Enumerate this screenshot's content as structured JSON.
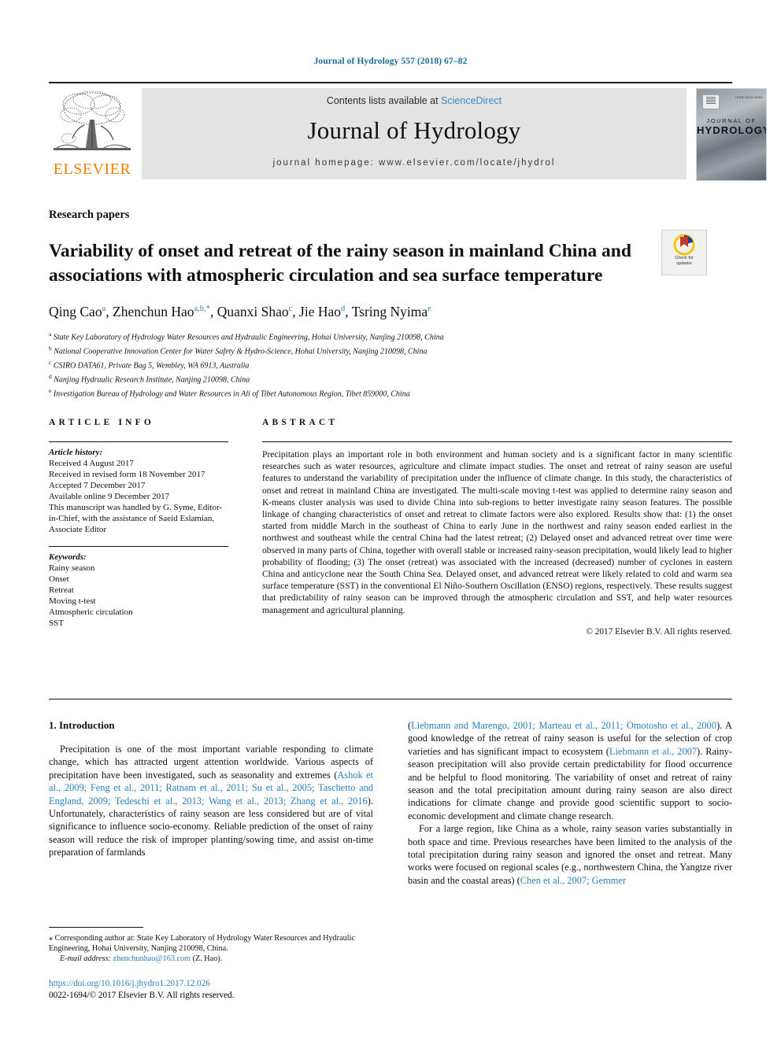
{
  "running_head": "Journal of Hydrology 557 (2018) 67–82",
  "masthead": {
    "publisher": "ELSEVIER",
    "contents_prefix": "Contents lists available at ",
    "contents_link": "ScienceDirect",
    "journal_title": "Journal of Hydrology",
    "homepage": "journal homepage: www.elsevier.com/locate/jhydrol",
    "cover": {
      "top_right": "ISSN 0022-1694",
      "line1": "JOURNAL OF",
      "line2": "HYDROLOGY"
    }
  },
  "article": {
    "type": "Research papers",
    "title": "Variability of onset and retreat of the rainy season in mainland China and associations with atmospheric circulation and sea surface temperature",
    "crossmark_line1": "Check for",
    "crossmark_line2": "updates"
  },
  "authors": {
    "list": [
      {
        "name": "Qing Cao",
        "sup": "a"
      },
      {
        "name": "Zhenchun Hao",
        "sup": "a,b,*"
      },
      {
        "name": "Quanxi Shao",
        "sup": "c"
      },
      {
        "name": "Jie Hao",
        "sup": "d"
      },
      {
        "name": "Tsring Nyima",
        "sup": "e"
      }
    ],
    "affiliations": [
      {
        "label": "a",
        "text": "State Key Laboratory of Hydrology Water Resources and Hydraulic Engineering, Hohai University, Nanjing 210098, China"
      },
      {
        "label": "b",
        "text": "National Cooperative Innovation Center for Water Safety & Hydro-Science, Hohai University, Nanjing 210098, China"
      },
      {
        "label": "c",
        "text": "CSIRO DATA61, Private Bag 5, Wembley, WA 6913, Australia"
      },
      {
        "label": "d",
        "text": "Nanjing Hydraulic Research Institute, Nanjing 210098, China"
      },
      {
        "label": "e",
        "text": "Investigation Bureau of Hydrology and Water Resources in Ali of Tibet Autonomous Region, Tibet 859000, China"
      }
    ]
  },
  "article_info": {
    "heading": "ARTICLE INFO",
    "history_label": "Article history:",
    "history": [
      "Received 4 August 2017",
      "Received in revised form 18 November 2017",
      "Accepted 7 December 2017",
      "Available online 9 December 2017"
    ],
    "handled_by": "This manuscript was handled by G. Syme, Editor-in-Chief, with the assistance of Saeid Eslamian, Associate Editor",
    "keywords_label": "Keywords:",
    "keywords": [
      "Rainy season",
      "Onset",
      "Retreat",
      "Moving t-test",
      "Atmospheric circulation",
      "SST"
    ]
  },
  "abstract": {
    "heading": "ABSTRACT",
    "text": "Precipitation plays an important role in both environment and human society and is a significant factor in many scientific researches such as water resources, agriculture and climate impact studies. The onset and retreat of rainy season are useful features to understand the variability of precipitation under the influence of climate change. In this study, the characteristics of onset and retreat in mainland China are investigated. The multi-scale moving t-test was applied to determine rainy season and K-means cluster analysis was used to divide China into sub-regions to better investigate rainy season features. The possible linkage of changing characteristics of onset and retreat to climate factors were also explored. Results show that: (1) the onset started from middle March in the southeast of China to early June in the northwest and rainy season ended earliest in the northwest and southeast while the central China had the latest retreat; (2) Delayed onset and advanced retreat over time were observed in many parts of China, together with overall stable or increased rainy-season precipitation, would likely lead to higher probability of flooding; (3) The onset (retreat) was associated with the increased (decreased) number of cyclones in eastern China and anticyclone near the South China Sea. Delayed onset, and advanced retreat were likely related to cold and warm sea surface temperature (SST) in the conventional El Niño-Southern Oscillation (ENSO) regions, respectively. These results suggest that predictability of rainy season can be improved through the atmospheric circulation and SST, and help water resources management and agricultural planning.",
    "copyright": "© 2017 Elsevier B.V. All rights reserved."
  },
  "introduction": {
    "heading": "1. Introduction",
    "left_p1_a": "Precipitation is one of the most important variable responding to climate change, which has attracted urgent attention worldwide. Various aspects of precipitation have been investigated, such as seasonality and extremes (",
    "left_p1_cite1": "Ashok et al., 2009; Feng et al., 2011; Ratnam et al., 2011; Su et al., 2005; Taschetto and England, 2009; Tedeschi et al., 2013; Wang et al., 2013; Zhang et al., 2016",
    "left_p1_b": "). Unfortunately, characteristics of rainy season are less considered but are of vital significance to influence socio-economy. Reliable prediction of the onset of rainy season will reduce the risk of improper planting/sowing time, and assist on-time preparation of farmlands",
    "right_p1_a": "(",
    "right_p1_cite1": "Liebmann and Marengo, 2001; Marteau et al., 2011; Omotosho et al., 2000",
    "right_p1_b": "). A good knowledge of the retreat of rainy season is useful for the selection of crop varieties and has significant impact to ecosystem (",
    "right_p1_cite2": "Liebmann et al., 2007",
    "right_p1_c": "). Rainy-season precipitation will also provide certain predictability for flood occurrence and be helpful to flood monitoring. The variability of onset and retreat of rainy season and the total precipitation amount during rainy season are also direct indications for climate change and provide good scientific support to socio-economic development and climate change research.",
    "right_p2_a": "For a large region, like China as a whole, rainy season varies substantially in both space and time. Previous researches have been limited to the analysis of the total precipitation during rainy season and ignored the onset and retreat. Many works were focused on regional scales (e.g., northwestern China, the Yangtze river basin and the coastal areas) (",
    "right_p2_cite1": "Chen et al., 2007; Gemmer"
  },
  "footnote": {
    "star": "⁎",
    "corresponding": "Corresponding author at: State Key Laboratory of Hydrology Water Resources and Hydraulic Engineering, Hohai University, Nanjing 210098, China.",
    "email_label": "E-mail address:",
    "email": "zhenchunhao@163.com",
    "email_owner": "(Z. Hao)."
  },
  "footer": {
    "doi": "https://doi.org/10.1016/j.jhydro1.2017.12.026",
    "issn_line": "0022-1694/© 2017 Elsevier B.V. All rights reserved."
  },
  "colors": {
    "link": "#2b7fb8",
    "elsevier_orange": "#ef8200",
    "band_grey": "#e3e3e3"
  }
}
